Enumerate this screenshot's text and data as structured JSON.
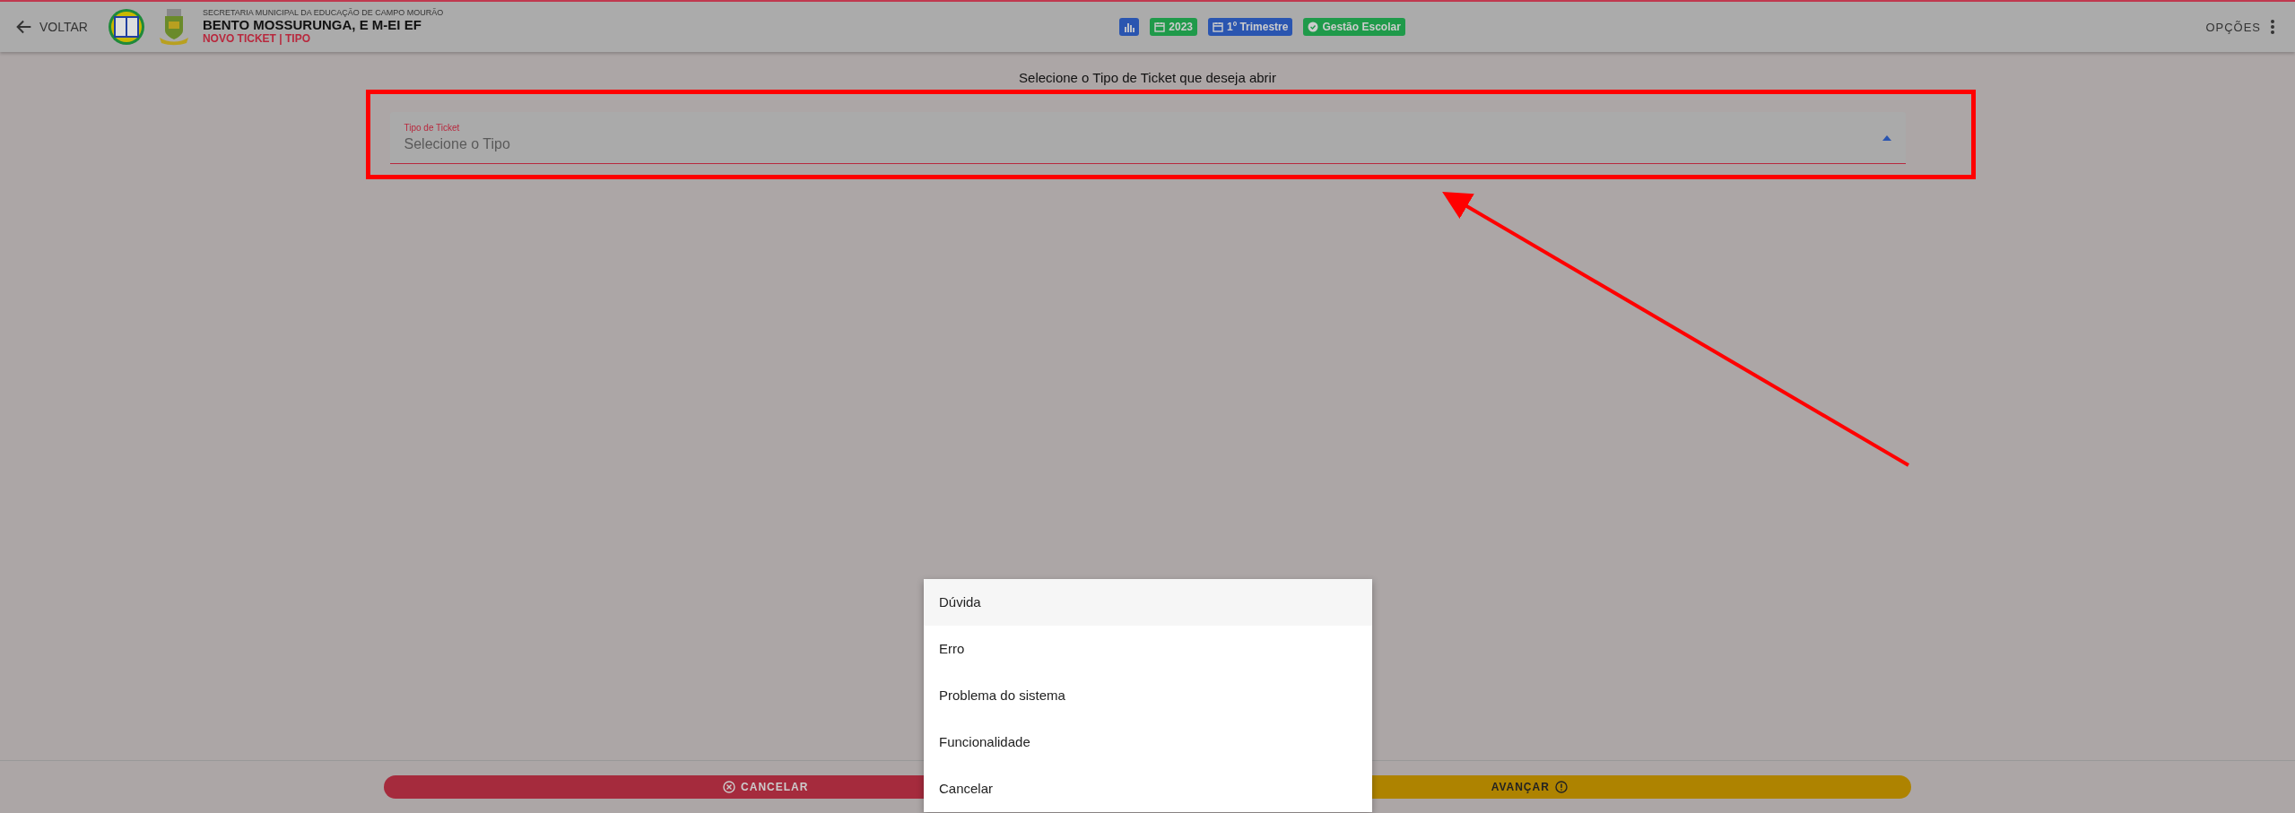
{
  "header": {
    "back_label": "VOLTAR",
    "department": "SECRETARIA MUNICIPAL DA EDUCAÇÃO DE CAMPO MOURÃO",
    "school": "BENTO MOSSURUNGA, E M-EI EF",
    "breadcrumb": "NOVO TICKET | TIPO",
    "badges": [
      {
        "kind": "chart",
        "color": "#2a55b0"
      },
      {
        "kind": "calendar",
        "label": "2023",
        "color": "#1f9a4a"
      },
      {
        "kind": "calendar",
        "label": "1º Trimestre",
        "color": "#2a55b0"
      },
      {
        "kind": "check",
        "label": "Gestão Escolar",
        "color": "#1f9a4a"
      }
    ],
    "options_label": "OPÇÕES"
  },
  "prompt": "Selecione o Tipo de Ticket que deseja abrir",
  "field": {
    "label": "Tipo de Ticket",
    "placeholder": "Selecione o Tipo",
    "expanded": true
  },
  "menu": {
    "items": [
      {
        "label": "Dúvida",
        "selected": true
      },
      {
        "label": "Erro",
        "selected": false
      },
      {
        "label": "Problema do sistema",
        "selected": false
      },
      {
        "label": "Funcionalidade",
        "selected": false
      },
      {
        "label": "Cancelar",
        "selected": false
      }
    ]
  },
  "footer": {
    "buttons": [
      {
        "kind": "cancel",
        "label": "CANCELAR"
      },
      {
        "kind": "next",
        "label": "AVANÇAR"
      }
    ]
  }
}
